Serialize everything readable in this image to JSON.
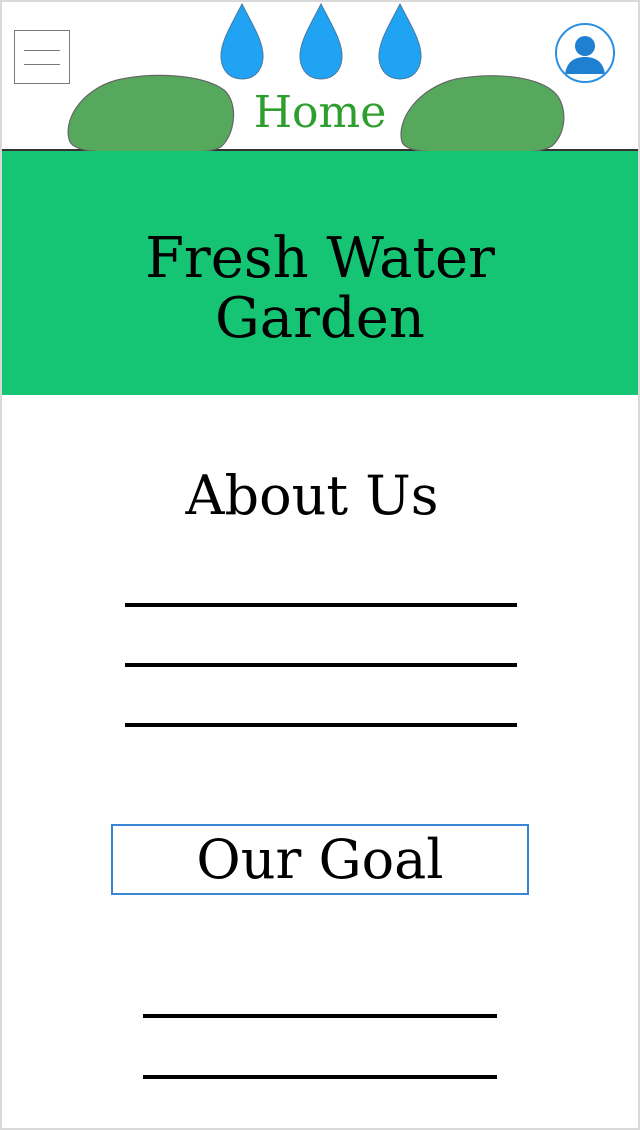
{
  "header": {
    "menu_icon": "hamburger-menu-icon",
    "home_label": "Home",
    "profile_icon": "user-profile-icon"
  },
  "banner": {
    "title_line1": "Fresh Water",
    "title_line2": "Garden"
  },
  "main": {
    "about_title": "About Us",
    "about_placeholder_lines": 3,
    "goal_button_label": "Our Goal",
    "goal_placeholder_lines": 2
  },
  "colors": {
    "banner": "#15c574",
    "home_text": "#2e9e2e",
    "water_drop": "#1fa3f2",
    "bush": "#56a85c",
    "accent_border": "#3a86d6"
  }
}
